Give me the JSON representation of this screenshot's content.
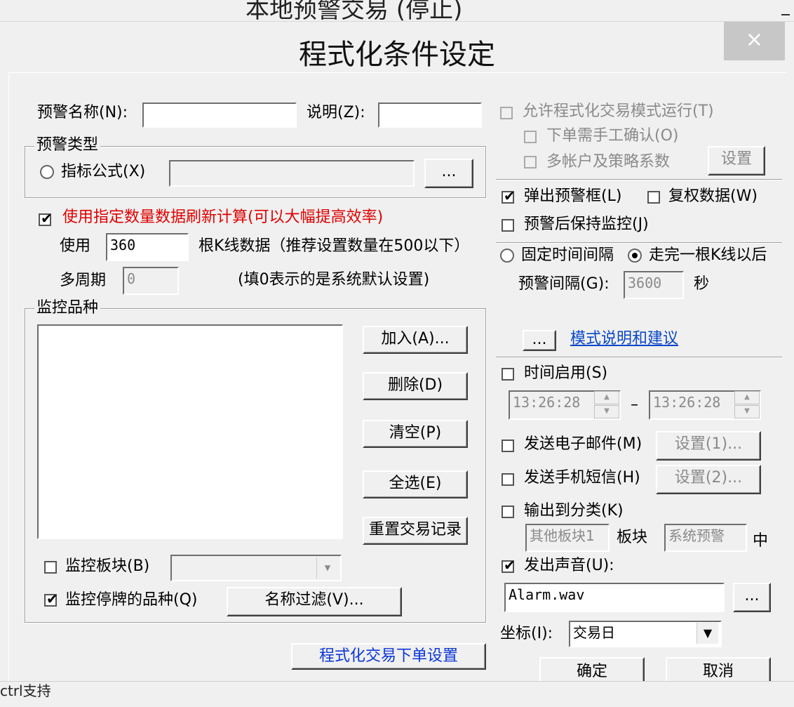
{
  "background": {
    "title": "本地预警交易 (停止)"
  },
  "dialog": {
    "title": "程式化条件设定",
    "close_glyph": "×"
  },
  "left": {
    "alert_name_label": "预警名称(N):",
    "desc_label": "说明(Z):",
    "type_group": {
      "legend": "预警类型",
      "formula_label": "指标公式(X)",
      "browse_label": "..."
    },
    "refresh_check_label": "使用指定数量数据刷新计算(可以大幅提高效率)",
    "use_label": "使用",
    "k_count_value": "360",
    "k_hint": "根K线数据（推荐设置数量在500以下）",
    "multi_period_label": "多周期",
    "multi_period_value": "0",
    "multi_period_hint": "(填0表示的是系统默认设置)",
    "monitor_group": {
      "legend": "监控品种",
      "add_label": "加入(A)...",
      "delete_label": "删除(D)",
      "clear_label": "清空(P)",
      "select_all_label": "全选(E)",
      "reset_label": "重置交易记录",
      "block_label": "监控板块(B)",
      "suspended_label": "监控停牌的品种(Q)",
      "name_filter_label": "名称过滤(V)..."
    },
    "order_settings_label": "程式化交易下单设置"
  },
  "right": {
    "allow_prog_label": "允许程式化交易模式运行(T)",
    "manual_confirm_label": "下单需手工确认(O)",
    "multi_account_label": "多帐户及策略系数",
    "multi_account_set_label": "设置",
    "popup_label": "弹出预警框(L)",
    "restore_label": "复权数据(W)",
    "keep_monitor_label": "预警后保持监控(J)",
    "fixed_interval_label": "固定时间间隔",
    "after_k_label": "走完一根K线以后",
    "interval_label": "预警间隔(G):",
    "interval_value": "3600",
    "interval_unit": "秒",
    "mode_browse_label": "...",
    "mode_link_label": "模式说明和建议",
    "time_enable_label": "时间启用(S)",
    "time_from": "13:26:28",
    "time_sep": "–",
    "time_to": "13:26:28",
    "email_label": "发送电子邮件(M)",
    "email_set_label": "设置(1)...",
    "sms_label": "发送手机短信(H)",
    "sms_set_label": "设置(2)...",
    "output_class_label": "输出到分类(K)",
    "other_block_value": "其他板块1",
    "block_word": "板块",
    "system_alert_value": "系统预警",
    "middle_word": "中",
    "sound_label": "发出声音(U):",
    "sound_file": "Alarm.wav",
    "sound_browse_label": "...",
    "coord_label": "坐标(I):",
    "coord_value": "交易日",
    "ok_label": "确定",
    "cancel_label": "取消"
  },
  "status": {
    "text": "ctrl支持"
  },
  "colors": {
    "accent_red": "#e00000",
    "link_blue": "#0a47c8",
    "close_bg": "#c7c7c7"
  }
}
